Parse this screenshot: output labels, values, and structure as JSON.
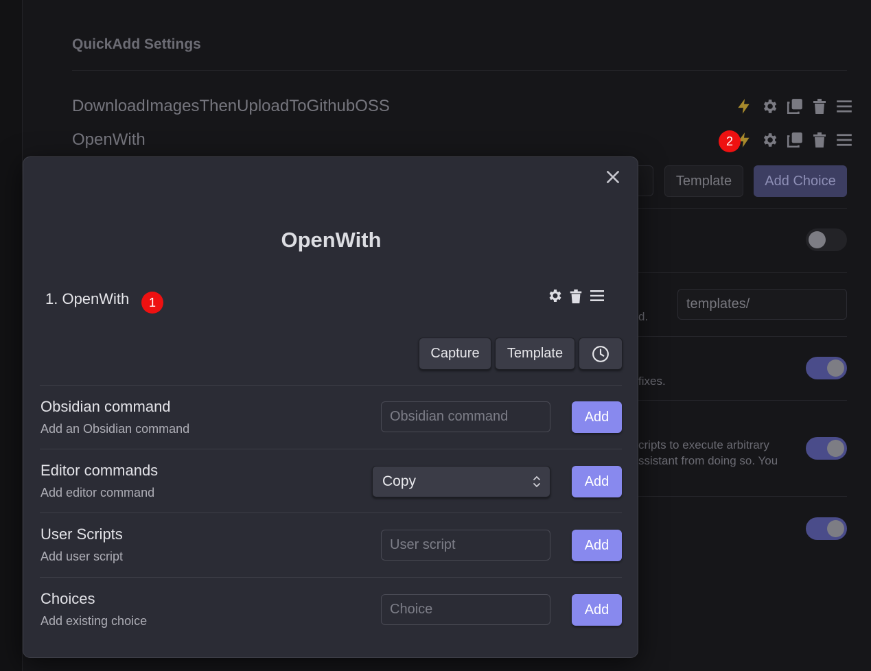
{
  "background": {
    "heading": "QuickAdd Settings",
    "choices": [
      {
        "name": "DownloadImagesThenUploadToGithubOSS"
      },
      {
        "name": "OpenWith"
      }
    ],
    "badge": "2",
    "template_button": "Template",
    "add_choice_button": "Add Choice",
    "template_folder_value": "templates/",
    "text_fragments": {
      "d": "d.",
      "fixes": "fixes.",
      "scripts_line1": "cripts to execute arbitrary",
      "scripts_line2": "ssistant from doing so. You"
    },
    "accent_color": "#4a4c8a"
  },
  "modal": {
    "title": "OpenWith",
    "command_item": "1. OpenWith",
    "badge": "1",
    "type_buttons": {
      "capture": "Capture",
      "template": "Template",
      "wait_icon": "clock-icon"
    },
    "settings": {
      "obsidian": {
        "name": "Obsidian command",
        "desc": "Add an Obsidian command",
        "placeholder": "Obsidian command",
        "button": "Add"
      },
      "editor": {
        "name": "Editor commands",
        "desc": "Add editor command",
        "selected": "Copy",
        "button": "Add"
      },
      "user_scripts": {
        "name": "User Scripts",
        "desc": "Add user script",
        "placeholder": "User script",
        "button": "Add"
      },
      "choices": {
        "name": "Choices",
        "desc": "Add existing choice",
        "placeholder": "Choice",
        "button": "Add"
      }
    },
    "accent_color": "#8889ee"
  }
}
